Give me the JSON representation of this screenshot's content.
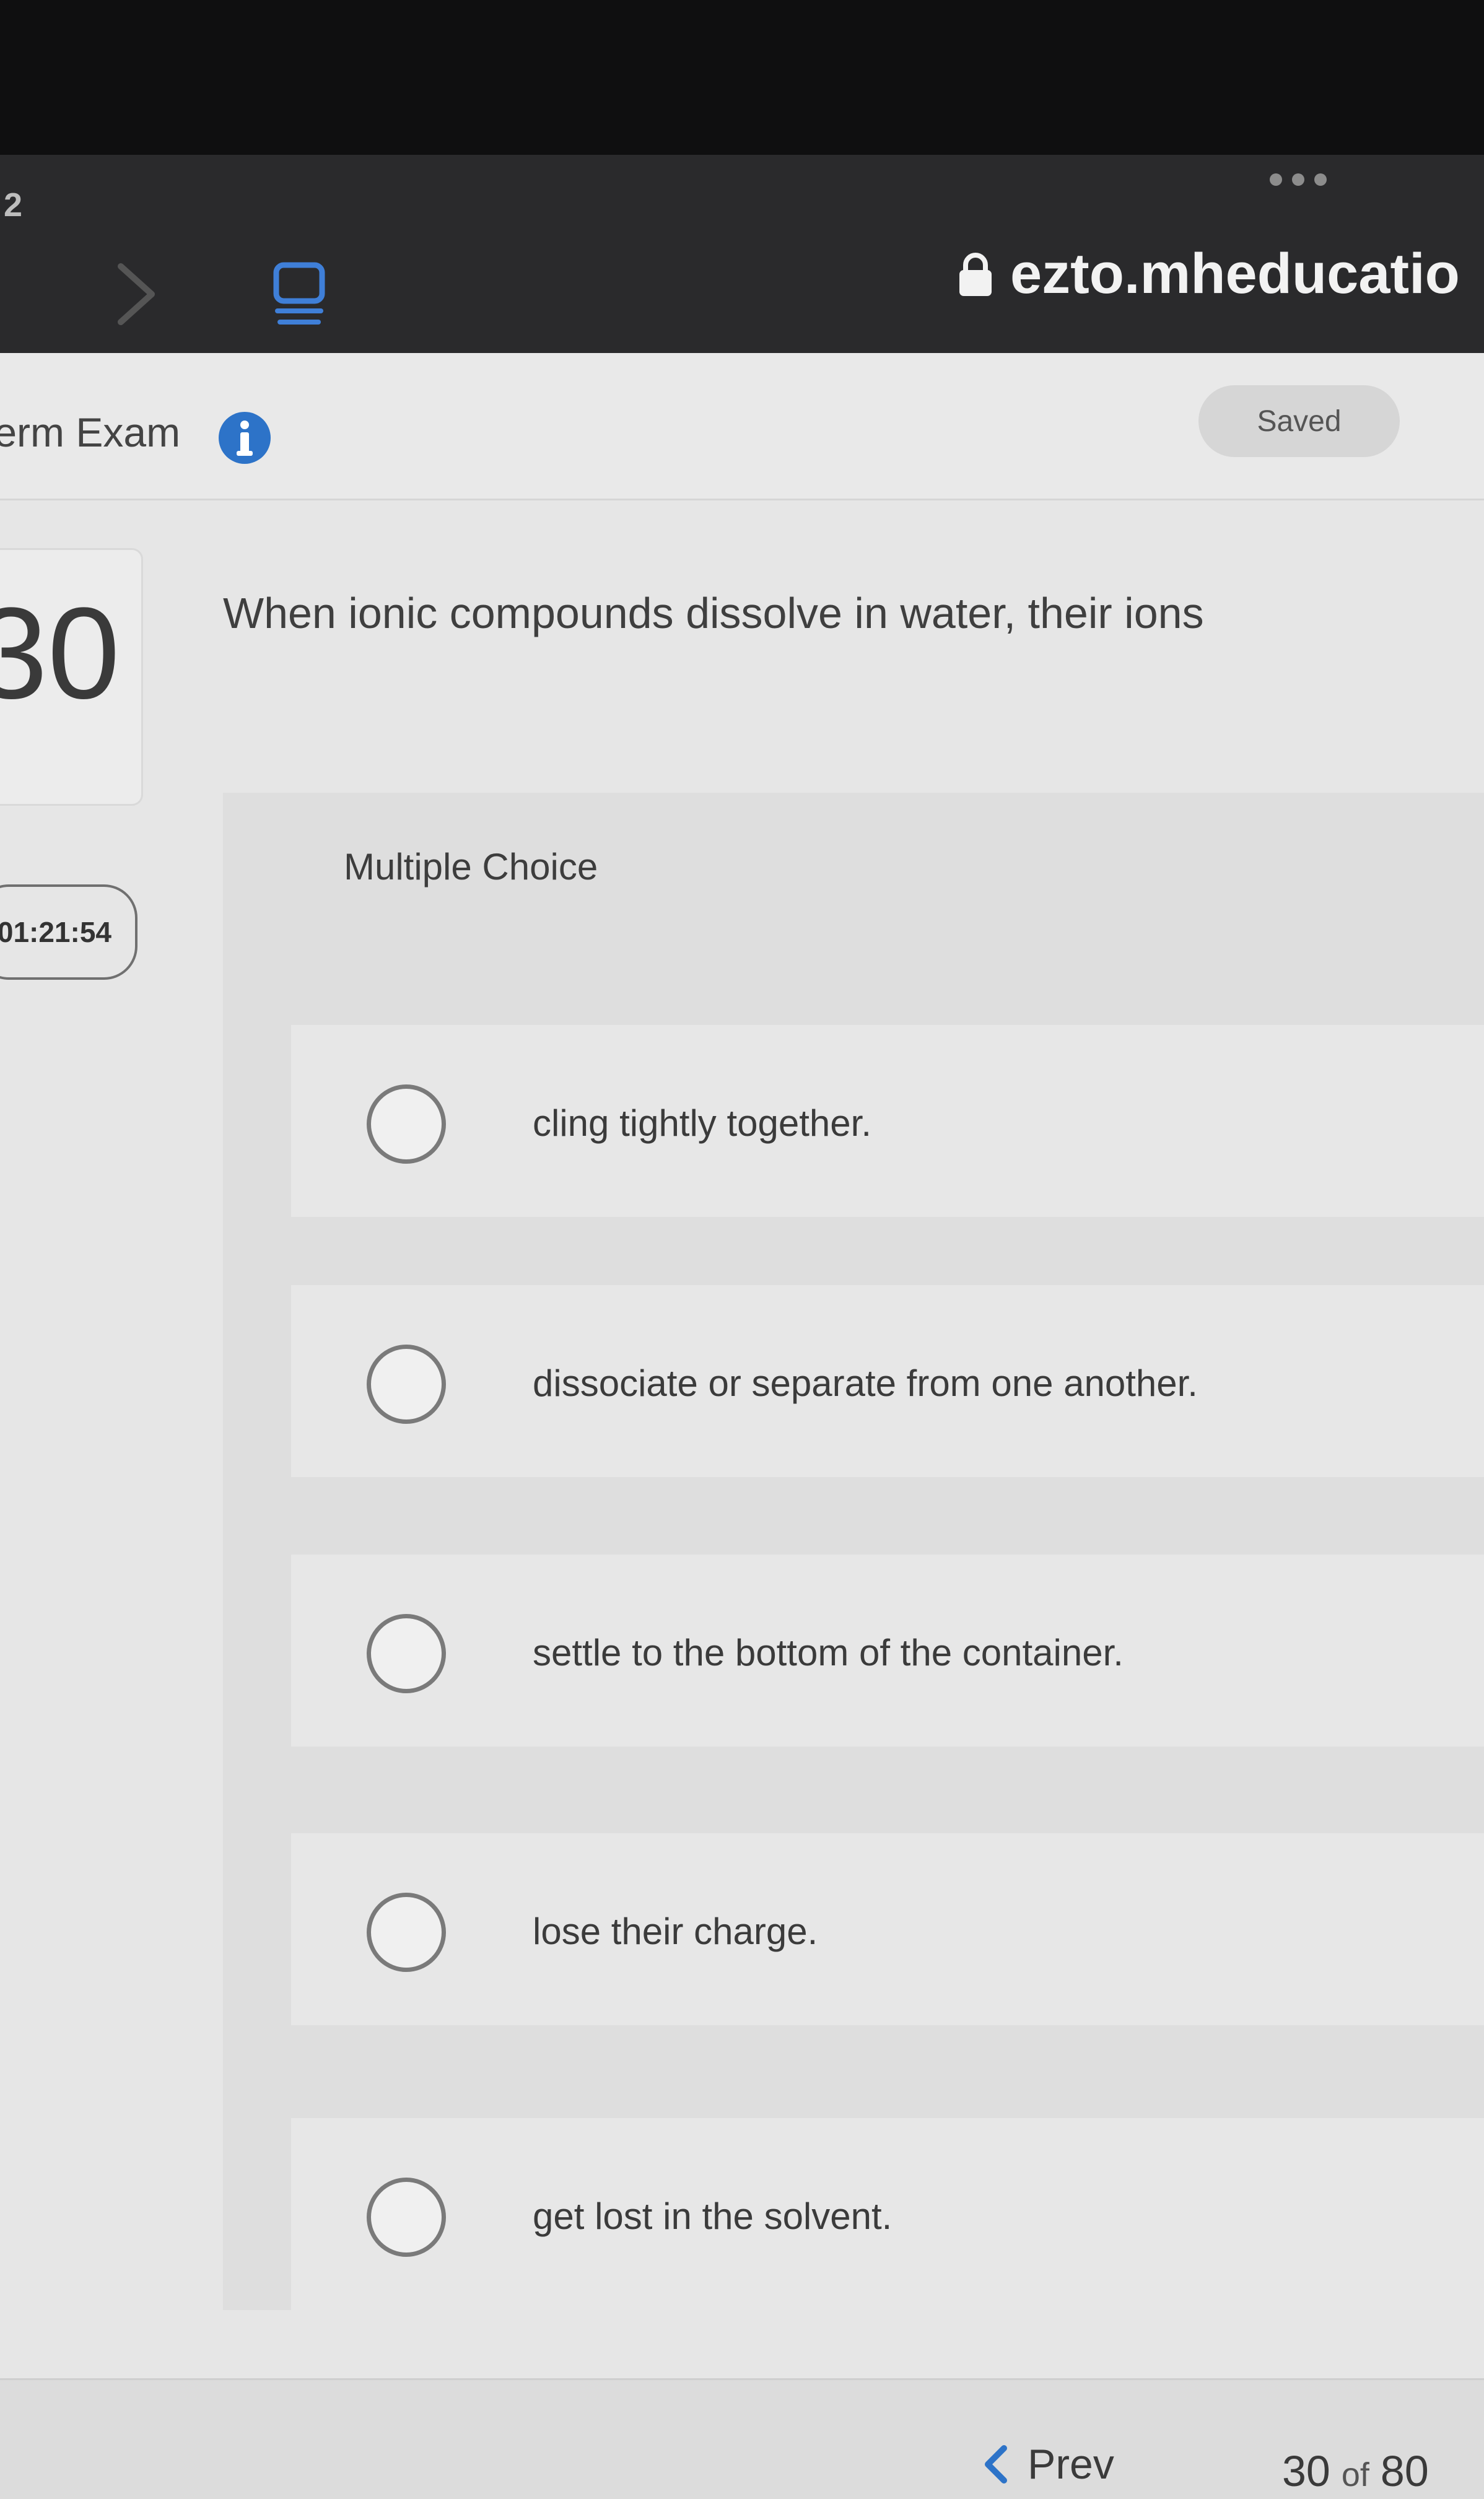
{
  "browser": {
    "tab_count": "2",
    "url": "ezto.mheducatio"
  },
  "header": {
    "exam_title": "term Exam",
    "saved_label": "Saved"
  },
  "sidebar": {
    "question_number": "30",
    "timer": "01:21:54"
  },
  "question": {
    "prompt": "When ionic compounds dissolve in water, their ions",
    "type_label": "Multiple Choice",
    "options": [
      "cling tightly together.",
      "dissociate or separate from one another.",
      "settle to the bottom of the container.",
      "lose their charge.",
      "get lost in the solvent."
    ]
  },
  "footer": {
    "prev_label": "Prev",
    "current": "30",
    "of_label": "of",
    "total": "80"
  }
}
